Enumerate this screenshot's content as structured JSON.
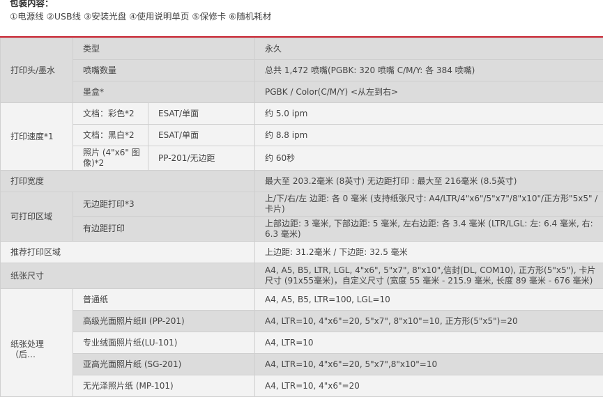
{
  "package": {
    "title": "包装内容：",
    "items": "①电源线 ②USB线 ③安装光盘 ④使用说明单页 ⑤保修卡 ⑥随机耗材"
  },
  "spec": {
    "print_head": {
      "group": "打印头/墨水",
      "rows": [
        {
          "label": "类型",
          "value": "永久"
        },
        {
          "label": "喷嘴数量",
          "value": "总共 1,472 喷嘴(PGBK: 320 喷嘴 C/M/Y: 各 384 喷嘴)"
        },
        {
          "label": "墨盒*",
          "value": "PGBK / Color(C/M/Y) <从左到右>"
        }
      ]
    },
    "print_speed": {
      "group": "打印速度*1",
      "rows": [
        {
          "label": "文档：彩色*2",
          "mode": "ESAT/单面",
          "value": "约 5.0 ipm"
        },
        {
          "label": "文档：黑白*2",
          "mode": "ESAT/单面",
          "value": "约 8.8 ipm"
        },
        {
          "label": "照片 (4\"x6\" 图像)*2",
          "mode": "PP-201/无边距",
          "value": "约 60秒"
        }
      ]
    },
    "print_width": {
      "label": "打印宽度",
      "value": "最大至 203.2毫米 (8英寸) 无边距打印 : 最大至 216毫米 (8.5英寸)"
    },
    "printable_area": {
      "group": "可打印区域",
      "rows": [
        {
          "label": "无边距打印*3",
          "value": "上/下/右/左 边距: 各 0 毫米 (支持纸张尺寸: A4/LTR/4\"x6\"/5\"x7\"/8\"x10\"/正方形\"5x5\" /卡片)"
        },
        {
          "label": "有边距打印",
          "value": "上部边距: 3 毫米, 下部边距: 5 毫米, 左右边距: 各 3.4 毫米 (LTR/LGL: 左: 6.4 毫米, 右: 6.3 毫米)"
        }
      ]
    },
    "recommended_area": {
      "label": "推荐打印区域",
      "value": "上边距: 31.2毫米 / 下边距: 32.5 毫米"
    },
    "paper_size": {
      "label": "纸张尺寸",
      "value": "A4, A5, B5, LTR, LGL, 4\"x6\", 5\"x7\", 8\"x10\",信封(DL, COM10), 正方形(5\"x5\"), 卡片尺寸 (91x55毫米)，自定义尺寸 (宽度 55 毫米 - 215.9 毫米, 长度 89 毫米 - 676 毫米)"
    },
    "paper_handling": {
      "group": "纸张处理（后…",
      "rows": [
        {
          "label": "普通纸",
          "value": "A4, A5, B5, LTR=100, LGL=10"
        },
        {
          "label": "高级光面照片纸II (PP-201)",
          "value": "A4, LTR=10, 4\"x6\"=20, 5\"x7\", 8\"x10\"=10, 正方形(5\"x5\")=20"
        },
        {
          "label": "专业绒面照片纸(LU-101)",
          "value": "A4, LTR=10"
        },
        {
          "label": "亚高光面照片纸 (SG-201)",
          "value": "A4, LTR=10, 4\"x6\"=20, 5\"x7\",8\"x10\"=10"
        },
        {
          "label": "无光泽照片纸 (MP-101)",
          "value": "A4, LTR=10, 4\"x6\"=20"
        }
      ]
    }
  }
}
